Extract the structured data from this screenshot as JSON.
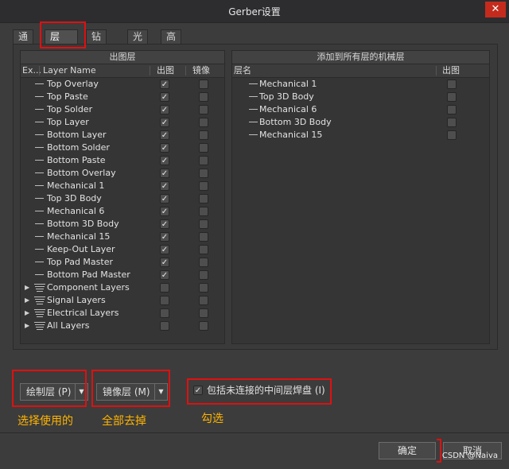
{
  "window": {
    "title": "Gerber设置",
    "close_glyph": "✕"
  },
  "tabs": [
    "通用",
    "层",
    "钻孔图层",
    "光圈",
    "高级"
  ],
  "left_panel": {
    "title": "出图层",
    "columns": {
      "expand": "Ex...",
      "name": "Layer Name",
      "plot": "出图",
      "mirror": "镜像"
    },
    "rows": [
      {
        "name": "Top Overlay",
        "plot": true,
        "mirror": false
      },
      {
        "name": "Top Paste",
        "plot": true,
        "mirror": false
      },
      {
        "name": "Top Solder",
        "plot": true,
        "mirror": false
      },
      {
        "name": "Top Layer",
        "plot": true,
        "mirror": false
      },
      {
        "name": "Bottom Layer",
        "plot": true,
        "mirror": false
      },
      {
        "name": "Bottom Solder",
        "plot": true,
        "mirror": false
      },
      {
        "name": "Bottom Paste",
        "plot": true,
        "mirror": false
      },
      {
        "name": "Bottom Overlay",
        "plot": true,
        "mirror": false
      },
      {
        "name": "Mechanical 1",
        "plot": true,
        "mirror": false
      },
      {
        "name": "Top 3D Body",
        "plot": true,
        "mirror": false
      },
      {
        "name": "Mechanical 6",
        "plot": true,
        "mirror": false
      },
      {
        "name": "Bottom 3D Body",
        "plot": true,
        "mirror": false
      },
      {
        "name": "Mechanical 15",
        "plot": true,
        "mirror": false
      },
      {
        "name": "Keep-Out Layer",
        "plot": true,
        "mirror": false
      },
      {
        "name": "Top Pad Master",
        "plot": true,
        "mirror": false
      },
      {
        "name": "Bottom Pad Master",
        "plot": true,
        "mirror": false
      }
    ],
    "groups": [
      {
        "name": "Component Layers",
        "plot": false,
        "mirror": false
      },
      {
        "name": "Signal Layers",
        "plot": false,
        "mirror": false
      },
      {
        "name": "Electrical Layers",
        "plot": false,
        "mirror": false
      },
      {
        "name": "All Layers",
        "plot": false,
        "mirror": false
      }
    ]
  },
  "right_panel": {
    "title": "添加到所有层的机械层",
    "columns": {
      "name": "层名",
      "plot": "出图"
    },
    "rows": [
      {
        "name": "Mechanical 1",
        "plot": false
      },
      {
        "name": "Top 3D Body",
        "plot": false
      },
      {
        "name": "Mechanical 6",
        "plot": false
      },
      {
        "name": "Bottom 3D Body",
        "plot": false
      },
      {
        "name": "Mechanical 15",
        "plot": false
      }
    ]
  },
  "controls": {
    "plot_layers_dropdown": "绘制层 (P)",
    "mirror_layers_dropdown": "镜像层 (M)",
    "include_unconnected": {
      "label": "包括未连接的中间层焊盘 (I)",
      "checked": true
    }
  },
  "annotations": {
    "plot": "选择使用的",
    "mirror": "全部去掉",
    "check": "勾选"
  },
  "buttons": {
    "ok": "确定",
    "cancel": "取消"
  },
  "watermark": "CSDN @Naiva",
  "colors": {
    "annotation_box": "#e01010",
    "annotation_text": "#ffb400"
  }
}
